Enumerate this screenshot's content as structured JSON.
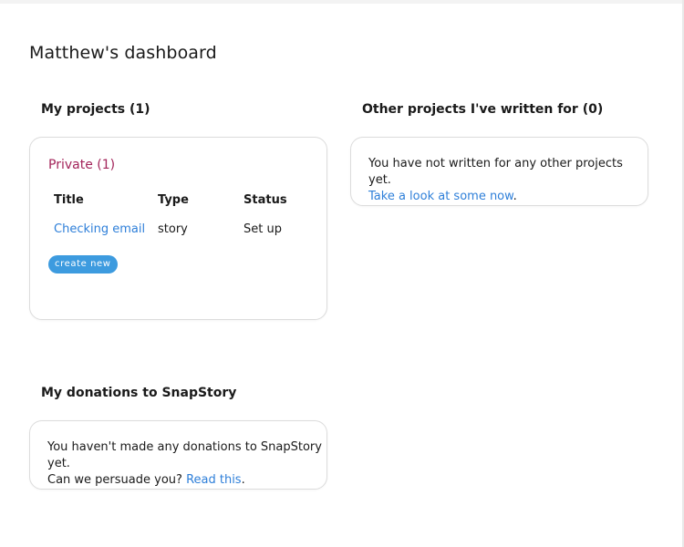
{
  "page": {
    "title": "Matthew's dashboard"
  },
  "my_projects": {
    "heading": "My projects (1)",
    "group_title": "Private (1)",
    "columns": [
      "Title",
      "Type",
      "Status"
    ],
    "rows": [
      {
        "title": "Checking email",
        "type": "story",
        "status": "Set up"
      }
    ],
    "create_button": "create new"
  },
  "other_projects": {
    "heading": "Other projects I've written for (0)",
    "message": "You have not written for any other projects yet.",
    "link_text": "Take a look at some now",
    "after_link": "."
  },
  "donations": {
    "heading": "My donations to SnapStory",
    "message_line1": "You haven't made any donations to SnapStory yet.",
    "message_line2": "Can we persuade you?",
    "link_text": "Read this",
    "after_link": "."
  },
  "colors": {
    "accent_link": "#2e7fd9",
    "group_title": "#a3245a",
    "button": "#3d9bdf"
  }
}
